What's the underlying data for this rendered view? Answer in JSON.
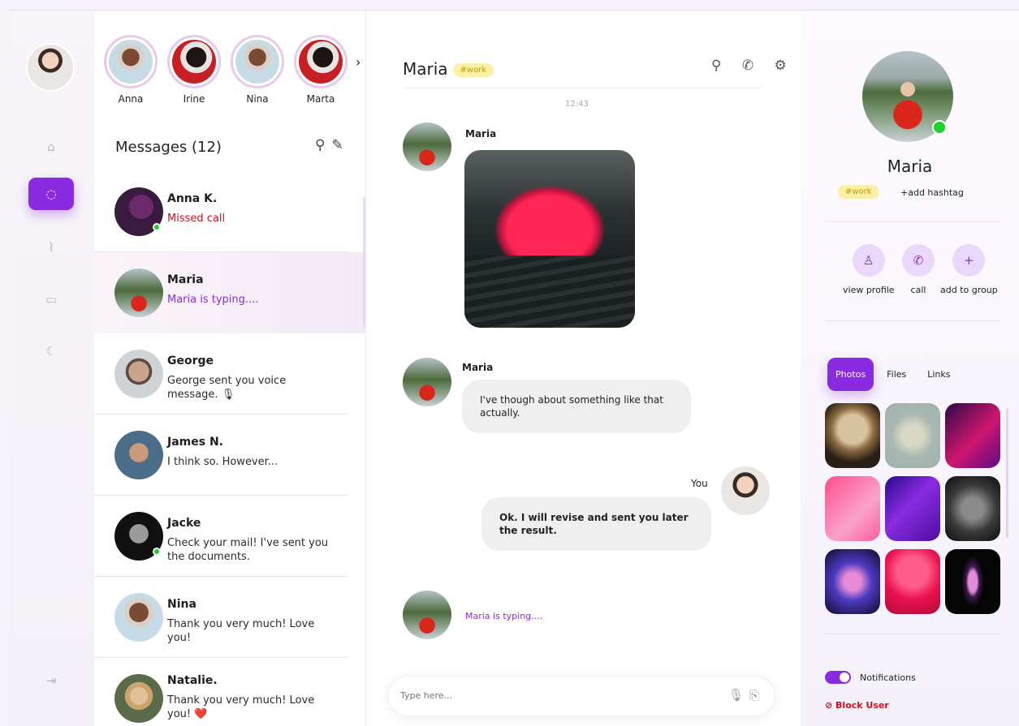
{
  "user": {
    "avatar_icon": "user-avatar-icon"
  },
  "nav": {
    "items": [
      {
        "name": "home",
        "glyph": "⌂"
      },
      {
        "name": "chat",
        "glyph": "◌"
      },
      {
        "name": "activity",
        "glyph": "⌇"
      },
      {
        "name": "video",
        "glyph": "▭"
      },
      {
        "name": "dark-mode",
        "glyph": "☾"
      },
      {
        "name": "logout",
        "glyph": "⇥"
      }
    ]
  },
  "stories": {
    "items": [
      {
        "name": "Anna"
      },
      {
        "name": "Irine"
      },
      {
        "name": "Nina"
      },
      {
        "name": "Marta"
      }
    ],
    "next_glyph": "›"
  },
  "messages": {
    "title": "Messages (12)",
    "search_glyph": "⚲",
    "compose_glyph": "✎",
    "items": [
      {
        "name": "Anna K.",
        "preview": "Missed call"
      },
      {
        "name": "Maria",
        "preview": "Maria is typing...."
      },
      {
        "name": "George",
        "preview": "George sent you voice message. 🎙"
      },
      {
        "name": "James N.",
        "preview": "I think so. However..."
      },
      {
        "name": "Jacke",
        "preview": "Check your mail! I've sent you the documents."
      },
      {
        "name": "Nina",
        "preview": "Thank you very much! Love you!"
      },
      {
        "name": "Natalie.",
        "preview": "Thank you very much! Love you! ❤️"
      }
    ]
  },
  "chat": {
    "title": "Maria",
    "tag": "#work",
    "icons": "⚲ ✆ ⚙",
    "time": "12:43",
    "messages": [
      {
        "sender": "Maria"
      },
      {
        "sender": "Maria",
        "text": "I've though about something like that actually."
      },
      {
        "sender": "You",
        "text": "Ok. I will revise and sent you later the result."
      }
    ],
    "typing": "Maria is typing....",
    "input_placeholder": "Type here...",
    "mic_glyph": "🎙",
    "attach_glyph": "⎘"
  },
  "profile": {
    "name": "Maria",
    "tag": "#work",
    "add_hashtag": "+add hashtag",
    "actions": [
      {
        "label": "view profile",
        "glyph": "♙"
      },
      {
        "label": "call",
        "glyph": "✆"
      },
      {
        "label": "add to group",
        "glyph": "+"
      }
    ],
    "tabs": [
      "Photos",
      "Files",
      "Links"
    ],
    "notifications": "Notifications",
    "block": "⊘ Block User"
  },
  "colors": {
    "accent": "#8a2be2",
    "online": "#1bd12c",
    "danger": "#d20f1e",
    "tag_bg": "#fbf1a6"
  }
}
